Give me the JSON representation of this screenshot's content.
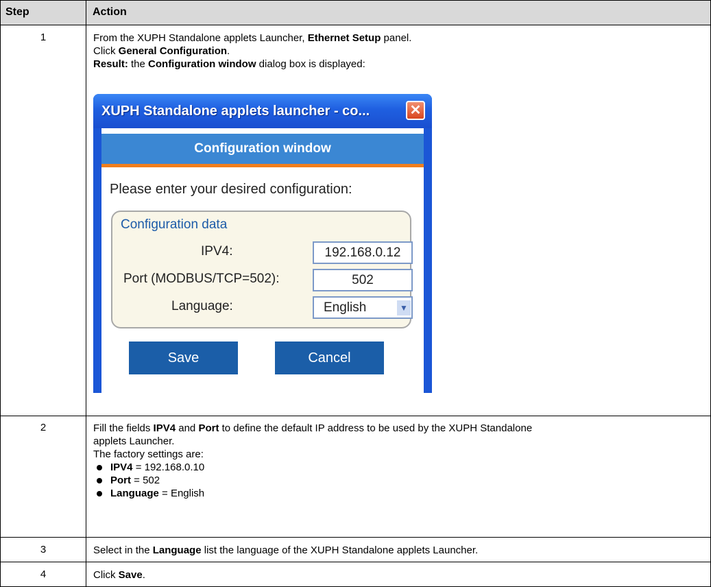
{
  "table": {
    "header_step": "Step",
    "header_action": "Action"
  },
  "rows": [
    {
      "step": "1",
      "lines": [
        [
          {
            "t": "From the XUPH Standalone applets Launcher, "
          },
          {
            "t": "Ethernet Setup",
            "b": true
          },
          {
            "t": " panel."
          }
        ],
        [
          {
            "t": "Click "
          },
          {
            "t": "General Configuration",
            "b": true
          },
          {
            "t": "."
          }
        ],
        [
          {
            "t": "Result:",
            "b": true
          },
          {
            "t": " the "
          },
          {
            "t": "Configuration window",
            "b": true
          },
          {
            "t": " dialog box is displayed:"
          }
        ]
      ]
    },
    {
      "step": "2",
      "lines": [
        [
          {
            "t": "Fill the fields "
          },
          {
            "t": "IPV4",
            "b": true
          },
          {
            "t": " and "
          },
          {
            "t": "Port",
            "b": true
          },
          {
            "t": " to define the default IP address to be used by the XUPH Standalone"
          }
        ],
        [
          {
            "t": "applets Launcher."
          }
        ],
        [
          {
            "t": "The factory settings are:"
          }
        ]
      ],
      "bullets": [
        [
          {
            "t": "IPV4",
            "b": true
          },
          {
            "t": " = 192.168.0.10"
          }
        ],
        [
          {
            "t": "Port",
            "b": true
          },
          {
            "t": " = 502"
          }
        ],
        [
          {
            "t": "Language",
            "b": true
          },
          {
            "t": " = English"
          }
        ]
      ]
    },
    {
      "step": "3",
      "lines": [
        [
          {
            "t": "Select in the "
          },
          {
            "t": "Language",
            "b": true
          },
          {
            "t": " list the language of the XUPH Standalone applets Launcher."
          }
        ]
      ]
    },
    {
      "step": "4",
      "lines": [
        [
          {
            "t": "Click "
          },
          {
            "t": "Save",
            "b": true
          },
          {
            "t": "."
          }
        ]
      ]
    }
  ],
  "dialog": {
    "title": "XUPH Standalone applets launcher - co...",
    "close_glyph": "✕",
    "banner": "Configuration window",
    "prompt": "Please enter your desired configuration:",
    "group_title": "Configuration data",
    "ipv4_label": "IPV4:",
    "ipv4_value": "192.168.0.12",
    "port_label": "Port (MODBUS/TCP=502):",
    "port_value": "502",
    "language_label": "Language:",
    "language_value": "English",
    "dropdown_glyph": "▼",
    "save_label": "Save",
    "cancel_label": "Cancel"
  },
  "colors": {
    "header_bg": "#d9d9d9",
    "titlebar": "#1f5fe0",
    "banner": "#3b87d3",
    "accent_orange": "#f07e1c",
    "button": "#1b5ea8",
    "group_title": "#1c5ba8"
  },
  "icons": {
    "close": "close-icon",
    "dropdown": "chevron-down-icon"
  }
}
